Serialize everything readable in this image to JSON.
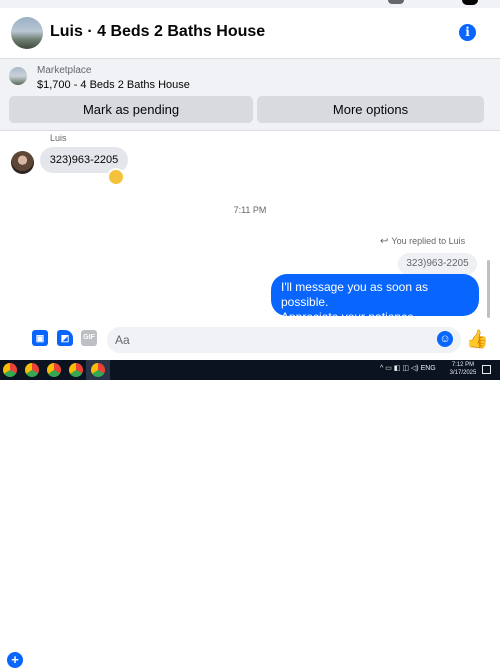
{
  "header": {
    "title": "Luis · 4 Beds 2 Baths House",
    "info_glyph": "i"
  },
  "listing": {
    "label": "Marketplace",
    "detail": "$1,700 - 4 Beds 2 Baths House",
    "buttons": {
      "pending": "Mark as pending",
      "more": "More options"
    }
  },
  "conversation": {
    "sender_name": "Luis",
    "incoming_message": "323)963-2205",
    "timestamp": "7:11 PM",
    "replied_label": "You replied to Luis",
    "quoted_message": "323)963-2205",
    "outgoing_line1": "I'll message you as soon as possible.",
    "outgoing_line2": "Appreciate your patience"
  },
  "composer": {
    "placeholder": "Aa",
    "gif_label": "GIF"
  },
  "taskbar": {
    "lang": "ENG",
    "time": "7:12 PM",
    "date": "3/17/2025"
  },
  "colors": {
    "accent": "#0866ff",
    "incoming_bubble": "#e4e6eb",
    "panel": "#f0f2f5"
  }
}
